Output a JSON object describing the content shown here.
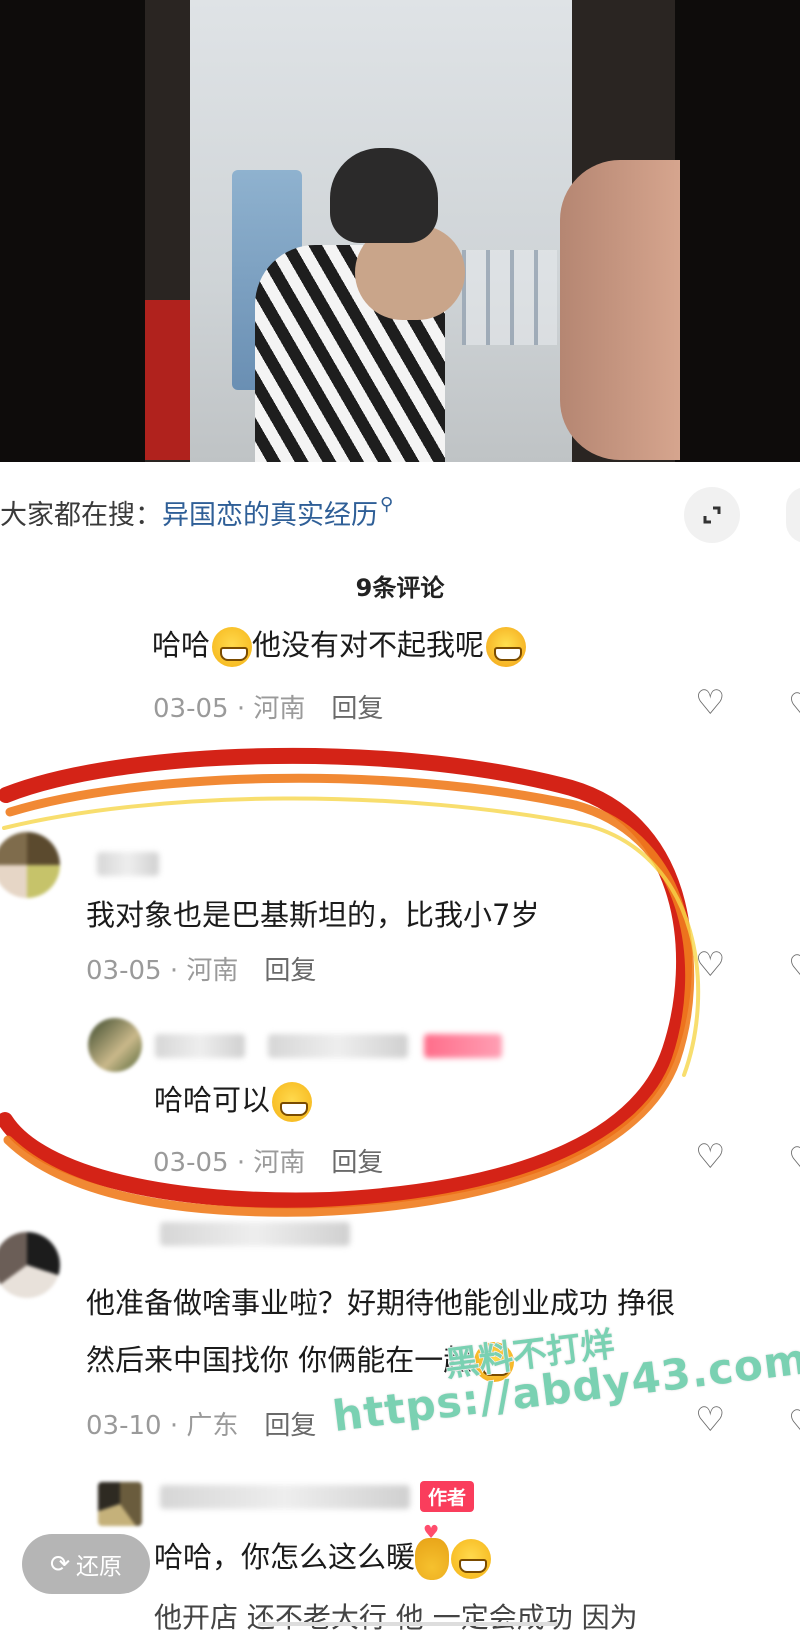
{
  "search": {
    "prefix": "大家都在搜：",
    "term": "异国恋的真实经历",
    "icon": "search-icon"
  },
  "comments_header": "9条评论",
  "comments": [
    {
      "text": "哈哈",
      "text_after_emoji": "他没有对不起我呢",
      "date": "03-05",
      "location": "河南",
      "reply_label": "回复"
    },
    {
      "text": "我对象也是巴基斯坦的，比我小7岁",
      "date": "03-05",
      "location": "河南",
      "reply_label": "回复",
      "reply": {
        "text": "哈哈可以",
        "date": "03-05",
        "location": "河南",
        "reply_label": "回复"
      }
    },
    {
      "text_line1": "他准备做啥事业啦？好期待他能创业成功 挣很",
      "text_line2": "然后来中国找你 你俩能在一起",
      "date": "03-10",
      "location": "广东",
      "reply_label": "回复"
    },
    {
      "author_badge": "作者",
      "text": "哈哈，你怎么这么暖",
      "text_cut": "他开店  还不老大行  他  一定会成功  因为"
    }
  ],
  "restore_button": "还原",
  "watermark": {
    "line1": "黑料不打烊",
    "line2": "https://abdy43.com"
  },
  "colors": {
    "search_term": "#2f5f97",
    "author_badge": "#fa3d5c",
    "annotation_red": "#d42317",
    "annotation_orange": "#f07c1e",
    "watermark": "#7ad1b2"
  }
}
